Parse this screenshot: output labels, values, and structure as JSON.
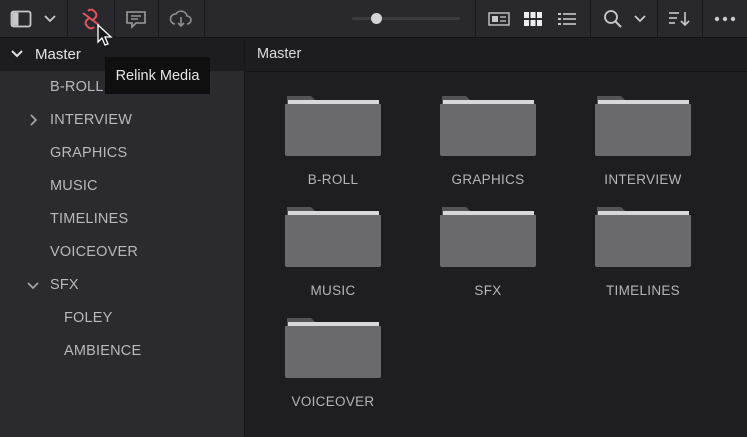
{
  "toolbar": {
    "buttons": [
      {
        "name": "panel-toggle-icon"
      },
      {
        "name": "chevron-down-icon"
      },
      {
        "name": "relink-media-icon",
        "color": "#e0555d"
      },
      {
        "name": "caption-icon"
      },
      {
        "name": "cloud-sync-icon"
      }
    ],
    "zoom_slider_fraction": 0.22,
    "view_buttons": [
      "metadata-view-icon",
      "thumbnail-view-icon",
      "list-view-icon"
    ],
    "search_icon": "search-icon",
    "sort_icon": "sort-icon",
    "more_icon": "more-icon"
  },
  "tooltip": {
    "text": "Relink Media"
  },
  "sidebar": {
    "master": "Master",
    "items": [
      {
        "label": "B-ROLL",
        "level": 1,
        "expander": ""
      },
      {
        "label": "INTERVIEW",
        "level": 1,
        "expander": "collapsed"
      },
      {
        "label": "GRAPHICS",
        "level": 1,
        "expander": ""
      },
      {
        "label": "MUSIC",
        "level": 1,
        "expander": ""
      },
      {
        "label": "TIMELINES",
        "level": 1,
        "expander": ""
      },
      {
        "label": "VOICEOVER",
        "level": 1,
        "expander": ""
      },
      {
        "label": "SFX",
        "level": 1,
        "expander": "expanded"
      },
      {
        "label": "FOLEY",
        "level": 2,
        "expander": ""
      },
      {
        "label": "AMBIENCE",
        "level": 2,
        "expander": ""
      }
    ]
  },
  "main": {
    "title": "Master",
    "folders": [
      {
        "label": "B-ROLL"
      },
      {
        "label": "GRAPHICS"
      },
      {
        "label": "INTERVIEW"
      },
      {
        "label": "MUSIC"
      },
      {
        "label": "SFX"
      },
      {
        "label": "TIMELINES"
      },
      {
        "label": "VOICEOVER"
      }
    ]
  },
  "colors": {
    "accent": "#e0555d",
    "folder": "#6a6a6e",
    "background": "#1e1e22"
  }
}
